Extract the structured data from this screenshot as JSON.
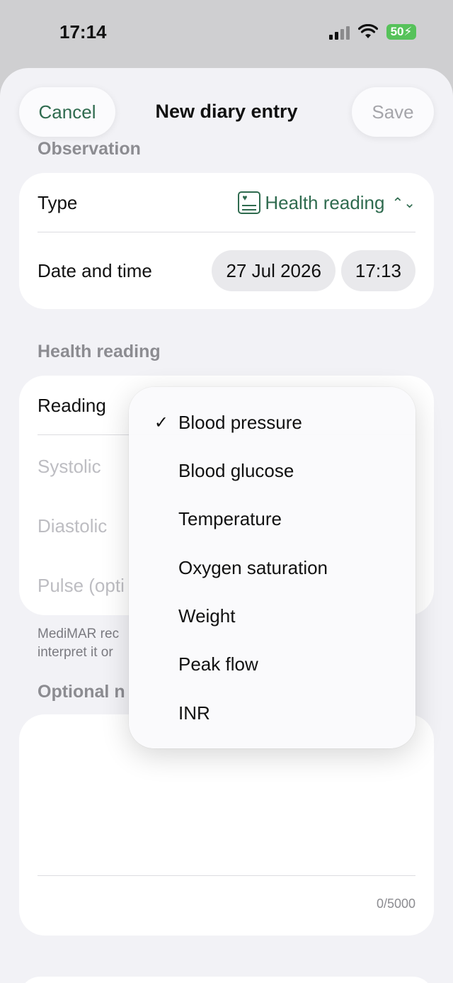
{
  "status_bar": {
    "time": "17:14",
    "battery": "50"
  },
  "nav": {
    "cancel": "Cancel",
    "title": "New diary entry",
    "save": "Save"
  },
  "observation": {
    "header": "Observation",
    "type_label": "Type",
    "type_value": "Health reading",
    "datetime_label": "Date and time",
    "date": "27 Jul 2026",
    "time": "17:13"
  },
  "health_reading": {
    "header": "Health reading",
    "reading_label": "Reading",
    "fields": [
      {
        "label": "Systolic"
      },
      {
        "label": "Diastolic"
      },
      {
        "label": "Pulse (opti"
      }
    ],
    "footnote_line1": "MediMAR rec",
    "footnote_line2": "interpret it or"
  },
  "notes": {
    "header": "Optional n",
    "counter": "0/5000"
  },
  "menu": {
    "selected_mark": "✓",
    "items": [
      {
        "label": "Blood pressure",
        "selected": true
      },
      {
        "label": "Blood glucose",
        "selected": false
      },
      {
        "label": "Temperature",
        "selected": false
      },
      {
        "label": "Oxygen saturation",
        "selected": false
      },
      {
        "label": "Weight",
        "selected": false
      },
      {
        "label": "Peak flow",
        "selected": false
      },
      {
        "label": "INR",
        "selected": false
      }
    ]
  },
  "colors": {
    "accent": "#2f6b4f",
    "background": "#f2f2f6",
    "muted": "#8c8c91"
  }
}
